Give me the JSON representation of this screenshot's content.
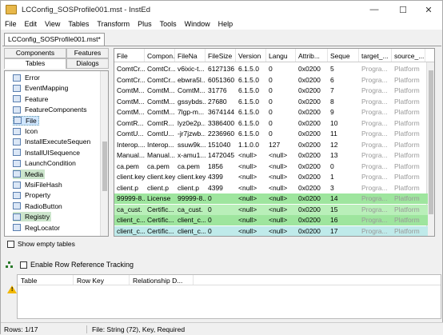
{
  "window": {
    "title": "LCConfig_SOSProfile001.mst - InstEd"
  },
  "menu": [
    "File",
    "Edit",
    "View",
    "Tables",
    "Transform",
    "Plus",
    "Tools",
    "Window",
    "Help"
  ],
  "doc_tab": "LCConfig_SOSProfile001.mst*",
  "left_tabs": {
    "components": "Components",
    "features": "Features",
    "tables": "Tables",
    "dialogs": "Dialogs"
  },
  "tables": [
    {
      "name": "Error",
      "state": ""
    },
    {
      "name": "EventMapping",
      "state": ""
    },
    {
      "name": "Feature",
      "state": ""
    },
    {
      "name": "FeatureComponents",
      "state": ""
    },
    {
      "name": "File",
      "state": "focused"
    },
    {
      "name": "Icon",
      "state": ""
    },
    {
      "name": "InstallExecuteSequen",
      "state": ""
    },
    {
      "name": "InstallUISequence",
      "state": ""
    },
    {
      "name": "LaunchCondition",
      "state": ""
    },
    {
      "name": "Media",
      "state": "changed"
    },
    {
      "name": "MsiFileHash",
      "state": ""
    },
    {
      "name": "Property",
      "state": ""
    },
    {
      "name": "RadioButton",
      "state": ""
    },
    {
      "name": "Registry",
      "state": "changed"
    },
    {
      "name": "RegLocator",
      "state": ""
    }
  ],
  "show_empty_label": "Show empty tables",
  "grid": {
    "columns": [
      "File",
      "Compon...",
      "FileNa",
      "FileSize",
      "Version",
      "Langu",
      "Attrib...",
      "Seque",
      "target_...",
      "source_..."
    ],
    "rows": [
      [
        "ComtCr...",
        "ComtCr...",
        "v6ixic-t...",
        "6127136",
        "6.1.5.0",
        "0",
        "0x0200",
        "5",
        "Progra...",
        "Platform"
      ],
      [
        "ComtCr...",
        "ComtCr...",
        "ebwra5l...",
        "6051360",
        "6.1.5.0",
        "0",
        "0x0200",
        "6",
        "Progra...",
        "Platform"
      ],
      [
        "ComtM...",
        "ComtM...",
        "ComtM...",
        "31776",
        "6.1.5.0",
        "0",
        "0x0200",
        "7",
        "Progra...",
        "Platform"
      ],
      [
        "ComtM...",
        "ComtM...",
        "gssybds...",
        "27680",
        "6.1.5.0",
        "0",
        "0x0200",
        "8",
        "Progra...",
        "Platform"
      ],
      [
        "ComtM...",
        "ComtM...",
        "7lgp-m...",
        "3674144",
        "6.1.5.0",
        "0",
        "0x0200",
        "9",
        "Progra...",
        "Platform"
      ],
      [
        "ComtR...",
        "ComtR...",
        "lyz0e2p...",
        "3386400",
        "6.1.5.0",
        "0",
        "0x0200",
        "10",
        "Progra...",
        "Platform"
      ],
      [
        "ComtU...",
        "ComtU...",
        "-jr7jzwb...",
        "2236960",
        "6.1.5.0",
        "0",
        "0x0200",
        "11",
        "Progra...",
        "Platform"
      ],
      [
        "Interop....",
        "Interop...",
        "ssuw9k...",
        "151040",
        "1.1.0.0",
        "127",
        "0x0200",
        "12",
        "Progra...",
        "Platform"
      ],
      [
        "Manual...",
        "Manual...",
        "x-amu1...",
        "1472045",
        "<null>",
        "<null>",
        "0x0200",
        "13",
        "Progra...",
        "Platform"
      ],
      [
        "ca.pem",
        "ca.pem",
        "ca.pem",
        "1856",
        "<null>",
        "<null>",
        "0x0200",
        "0",
        "Progra...",
        "Platform"
      ],
      [
        "client.key",
        "client.key",
        "client.key",
        "4399",
        "<null>",
        "<null>",
        "0x0200",
        "1",
        "Progra...",
        "Platform"
      ],
      [
        "client.p",
        "client.p",
        "client.p",
        "4399",
        "<null>",
        "<null>",
        "0x0200",
        "3",
        "Progra...",
        "Platform"
      ],
      [
        "99999-8...",
        "License",
        "99999-8...",
        "0",
        "<null>",
        "<null>",
        "0x0200",
        "14",
        "Progra...",
        "Platform"
      ],
      [
        "ca_cust.",
        "Certific...",
        "ca_cust.",
        "0",
        "<null>",
        "<null>",
        "0x0200",
        "15",
        "Progra...",
        "Platform"
      ],
      [
        "client_c...",
        "Certific...",
        "client_c...",
        "0",
        "<null>",
        "<null>",
        "0x0200",
        "16",
        "Progra...",
        "Platform"
      ],
      [
        "client_c...",
        "Certific...",
        "client_c...",
        "0",
        "<null>",
        "<null>",
        "0x0200",
        "17",
        "Progra...",
        "Platform"
      ]
    ],
    "row_styles": [
      "",
      "",
      "",
      "",
      "",
      "",
      "",
      "",
      "",
      "",
      "",
      "",
      "g",
      "gl",
      "g",
      "c2"
    ]
  },
  "relation": {
    "tracking_label": "Enable Row Reference Tracking",
    "columns": [
      "Table",
      "Row Key",
      "Relationship D..."
    ]
  },
  "status": {
    "rows": "Rows: 1/17",
    "info": "File: String (72), Key, Required"
  }
}
